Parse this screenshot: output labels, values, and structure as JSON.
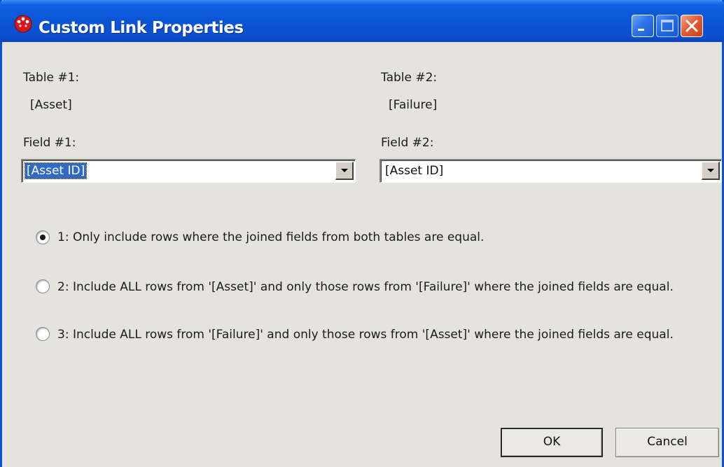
{
  "window": {
    "title": "Custom Link Properties"
  },
  "colors": {
    "titlebar": "#0a55d6",
    "dialog_bg": "#e5e3de",
    "selection": "#316ac5",
    "close_button": "#e25d34"
  },
  "table1": {
    "label": "Table #1:",
    "value": "[Asset]"
  },
  "table2": {
    "label": "Table #2:",
    "value": "[Failure]"
  },
  "field1": {
    "label": "Field #1:",
    "selected": "[Asset ID]"
  },
  "field2": {
    "label": "Field #2:",
    "selected": "[Asset ID]"
  },
  "join_options": [
    {
      "text": "1:  Only include rows where the joined fields from both tables are equal.",
      "checked": true
    },
    {
      "text": "2:  Include ALL rows from '[Asset]' and only those rows from '[Failure]' where the joined fields are equal.",
      "checked": false
    },
    {
      "text": "3:  Include ALL rows from '[Failure]' and only those rows from '[Asset]' where the joined fields are equal.",
      "checked": false
    }
  ],
  "buttons": {
    "ok": "OK",
    "cancel": "Cancel"
  },
  "icons": {
    "app": "app-logo-icon",
    "minimize": "minimize-icon",
    "maximize": "maximize-icon",
    "close": "close-icon",
    "dropdown": "chevron-down-icon"
  }
}
